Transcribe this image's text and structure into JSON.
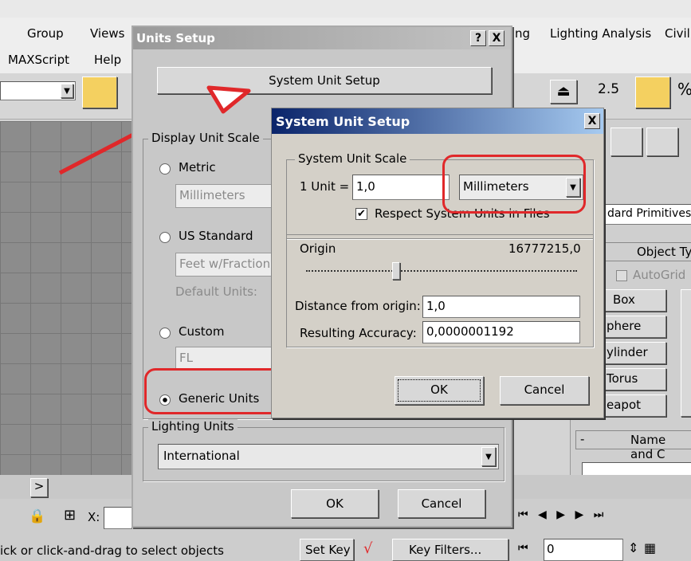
{
  "app": {
    "menu": [
      "Group",
      "Views",
      "MAXScript",
      "Help",
      "ng",
      "Lighting Analysis",
      "Civil"
    ],
    "toolbar_numbers": [
      "2.5",
      "%"
    ],
    "right_panel": {
      "primitives_dropdown": "dard Primitives",
      "object_type_header": "Object Ty",
      "autogrid_label": "AutoGrid",
      "object_buttons": [
        "Box",
        "phere",
        "ylinder",
        "Torus",
        "eapot"
      ],
      "name_and_color_header": "Name and C"
    },
    "status_text": "ick or click-and-drag to select objects",
    "x_label": "X:",
    "set_key_label": "Set Key",
    "key_filters_label": "Key Filters...",
    "frame_value": "0",
    "timeline_arrow": ">"
  },
  "units_setup": {
    "title": "Units Setup",
    "help_button": "?",
    "close_button": "X",
    "system_unit_setup_button": "System Unit Setup",
    "display_unit_scale_legend": "Display Unit Scale",
    "metric_label": "Metric",
    "metric_value": "Millimeters",
    "us_standard_label": "US Standard",
    "us_standard_value": "Feet w/Fraction",
    "default_units_label": "Default Units:",
    "custom_label": "Custom",
    "custom_value": "FL",
    "generic_units_label": "Generic Units",
    "lighting_units_legend": "Lighting Units",
    "lighting_units_value": "International",
    "ok_label": "OK",
    "cancel_label": "Cancel"
  },
  "system_unit_setup": {
    "title": "System Unit Setup",
    "close_button": "X",
    "scale_legend": "System Unit Scale",
    "one_unit_label": "1 Unit =",
    "unit_value": "1,0",
    "unit_type": "Millimeters",
    "respect_label": "Respect System Units in Files",
    "origin_label": "Origin",
    "origin_value": "16777215,0",
    "distance_label": "Distance from origin:",
    "distance_value": "1,0",
    "accuracy_label": "Resulting Accuracy:",
    "accuracy_value": "0,0000001192",
    "ok_label": "OK",
    "cancel_label": "Cancel"
  },
  "colors": {
    "highlight": "#e0282a",
    "title_active": "#0a246a"
  }
}
